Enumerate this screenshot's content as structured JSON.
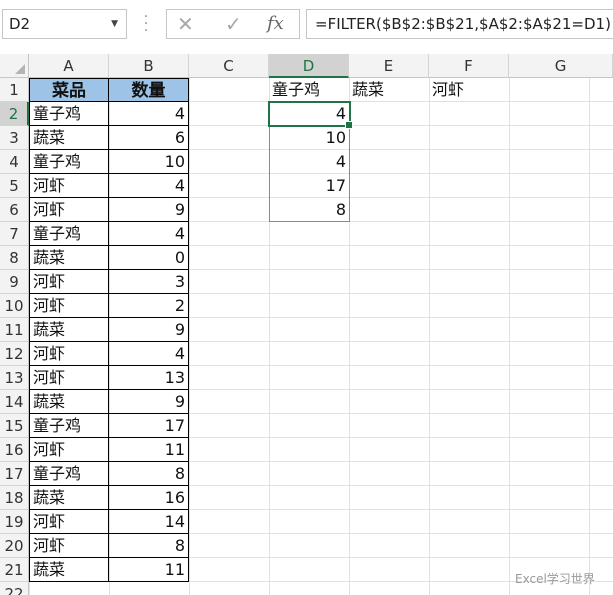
{
  "formula_bar": {
    "name_box": "D2",
    "cancel_icon": "✕",
    "enter_icon": "✓",
    "fx_label": "fx",
    "formula": "=FILTER($B$2:$B$21,$A$2:$A$21=D1)"
  },
  "columns": [
    "A",
    "B",
    "C",
    "D",
    "E",
    "F",
    "G"
  ],
  "rows": [
    "1",
    "2",
    "3",
    "4",
    "5",
    "6",
    "7",
    "8",
    "9",
    "10",
    "11",
    "12",
    "13",
    "14",
    "15",
    "16",
    "17",
    "18",
    "19",
    "20",
    "21",
    "22"
  ],
  "selected_column": "D",
  "selected_row": "2",
  "table": {
    "header": [
      "菜品",
      "数量"
    ],
    "rows": [
      [
        "童子鸡",
        "4"
      ],
      [
        "蔬菜",
        "6"
      ],
      [
        "童子鸡",
        "10"
      ],
      [
        "河虾",
        "4"
      ],
      [
        "河虾",
        "9"
      ],
      [
        "童子鸡",
        "4"
      ],
      [
        "蔬菜",
        "0"
      ],
      [
        "河虾",
        "3"
      ],
      [
        "河虾",
        "2"
      ],
      [
        "蔬菜",
        "9"
      ],
      [
        "河虾",
        "4"
      ],
      [
        "河虾",
        "13"
      ],
      [
        "蔬菜",
        "9"
      ],
      [
        "童子鸡",
        "17"
      ],
      [
        "河虾",
        "11"
      ],
      [
        "童子鸡",
        "8"
      ],
      [
        "蔬菜",
        "16"
      ],
      [
        "河虾",
        "14"
      ],
      [
        "河虾",
        "8"
      ],
      [
        "蔬菜",
        "11"
      ]
    ]
  },
  "criteria": [
    "童子鸡",
    "蔬菜",
    "河虾"
  ],
  "spill_results": [
    "4",
    "10",
    "4",
    "17",
    "8"
  ],
  "watermark": "Excel学习世界",
  "colors": {
    "header_fill": "#9dc3e6",
    "accent": "#217346",
    "spill_border": "#6a8fc7"
  }
}
